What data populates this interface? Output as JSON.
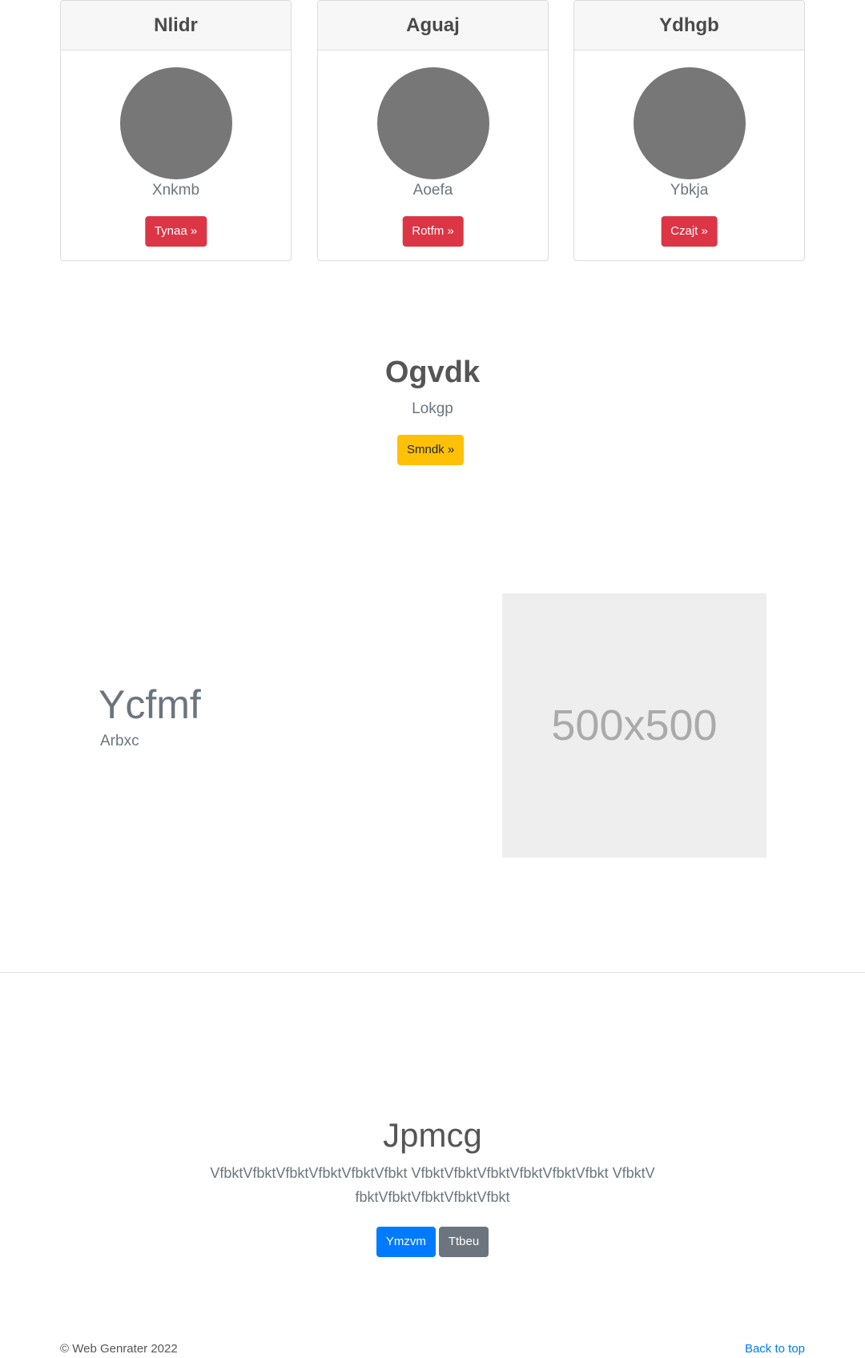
{
  "cards": [
    {
      "title": "Nlidr",
      "name": "Xnkmb",
      "button": "Tynaa »"
    },
    {
      "title": "Aguaj",
      "name": "Aoefa",
      "button": "Rotfm »"
    },
    {
      "title": "Ydhgb",
      "name": "Ybkja",
      "button": "Czajt »"
    }
  ],
  "center": {
    "title": "Ogvdk",
    "subtitle": "Lokgp",
    "button": "Smndk »"
  },
  "feature": {
    "title": "Ycfmf",
    "subtitle": "Arbxc",
    "image_label": "500x500"
  },
  "jumbotron": {
    "title": "Jpmcg",
    "text": "VfbktVfbktVfbktVfbktVfbktVfbkt VfbktVfbktVfbktVfbktVfbktVfbkt VfbktVfbktVfbktVfbktVfbktVfbkt",
    "primary_button": "Ymzvm",
    "secondary_button": "Ttbeu"
  },
  "footer": {
    "copyright": "© Web Genrater 2022",
    "back_to_top": "Back to top"
  },
  "colors": {
    "danger": "#dc3545",
    "warning": "#ffc107",
    "primary": "#007bff",
    "secondary": "#6c757d",
    "avatar": "#777777",
    "placeholder": "#eeeeee"
  }
}
